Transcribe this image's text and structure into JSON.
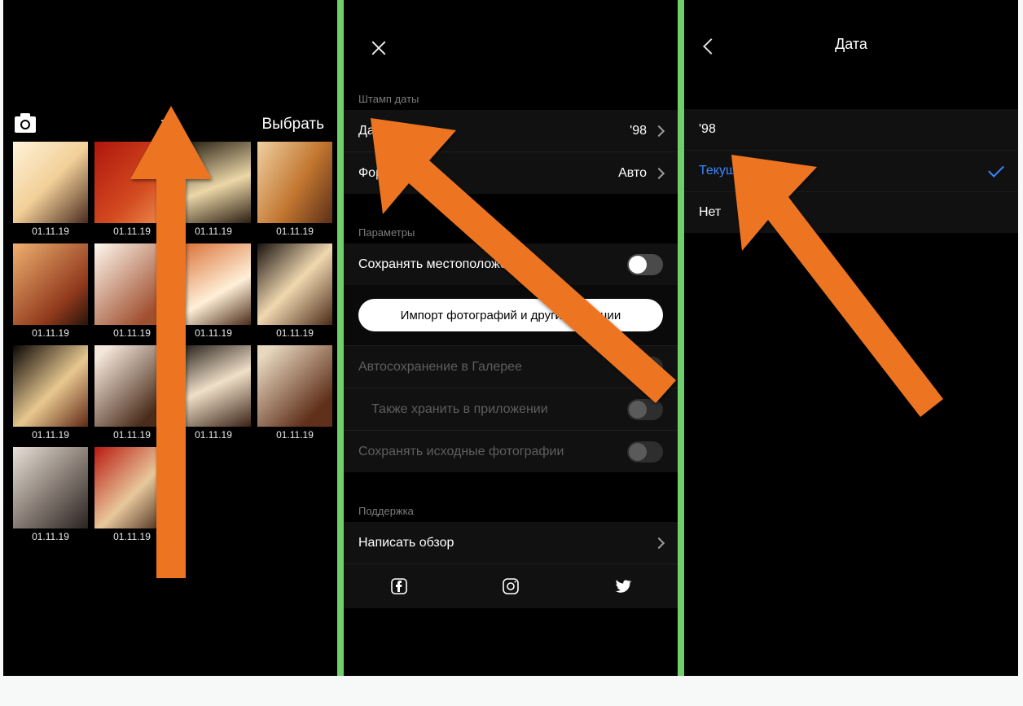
{
  "screen1": {
    "select_label": "Выбрать",
    "dates": [
      "01.11.19",
      "01.11.19",
      "01.11.19",
      "01.11.19",
      "01.11.19",
      "01.11.19",
      "01.11.19",
      "01.11.19",
      "01.11.19",
      "01.11.19",
      "01.11.19",
      "01.11.19",
      "01.11.19",
      "01.11.19"
    ]
  },
  "screen2": {
    "section_stamp": "Штамп даты",
    "date_label": "Дата",
    "date_value": "'98",
    "format_label": "Формат",
    "format_value": "Авто",
    "section_params": "Параметры",
    "save_location": "Сохранять местоположение",
    "import_button": "Импорт фотографий и другие функции",
    "autosave_gallery": "Автосохранение в Галерее",
    "also_store": "Также хранить в приложении",
    "save_originals": "Сохранять исходные фотографии",
    "section_support": "Поддержка",
    "write_review": "Написать обзор"
  },
  "screen3": {
    "title": "Дата",
    "opt_98": "'98",
    "opt_current": "Текущая",
    "opt_none": "Нет"
  }
}
